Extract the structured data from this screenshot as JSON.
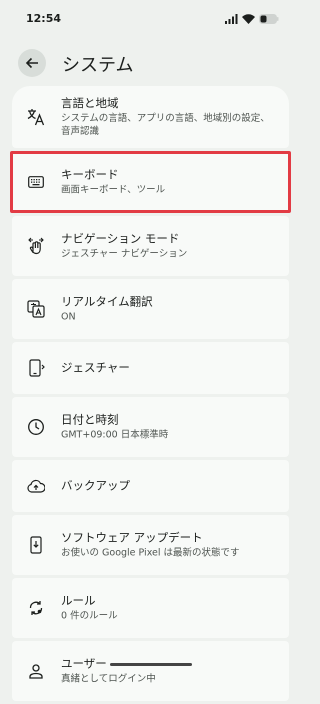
{
  "status": {
    "time": "12:54"
  },
  "header": {
    "title": "システム"
  },
  "items": [
    {
      "title": "言語と地域",
      "subtitle": "システムの言語、アプリの言語、地域別の設定、音声認識",
      "icon": "translate-icon"
    },
    {
      "title": "キーボード",
      "subtitle": "画面キーボード、ツール",
      "icon": "keyboard-icon"
    },
    {
      "title": "ナビゲーション モード",
      "subtitle": "ジェスチャー ナビゲーション",
      "icon": "gesture-nav-icon"
    },
    {
      "title": "リアルタイム翻訳",
      "subtitle": "ON",
      "icon": "live-translate-icon"
    },
    {
      "title": "ジェスチャー",
      "subtitle": "",
      "icon": "gesture-phone-icon"
    },
    {
      "title": "日付と時刻",
      "subtitle": "GMT+09:00 日本標準時",
      "icon": "clock-icon"
    },
    {
      "title": "バックアップ",
      "subtitle": "",
      "icon": "cloud-upload-icon"
    },
    {
      "title": "ソフトウェア アップデート",
      "subtitle": "お使いの Google Pixel は最新の状態です",
      "icon": "system-update-icon"
    },
    {
      "title": "ルール",
      "subtitle": "0 件のルール",
      "icon": "rules-icon"
    },
    {
      "title": "ユーザー",
      "subtitle": "真緒としてログイン中",
      "icon": "person-icon"
    }
  ],
  "colors": {
    "highlight": "#e23b44",
    "background": "#eef1ee",
    "card": "#f8faf8"
  }
}
